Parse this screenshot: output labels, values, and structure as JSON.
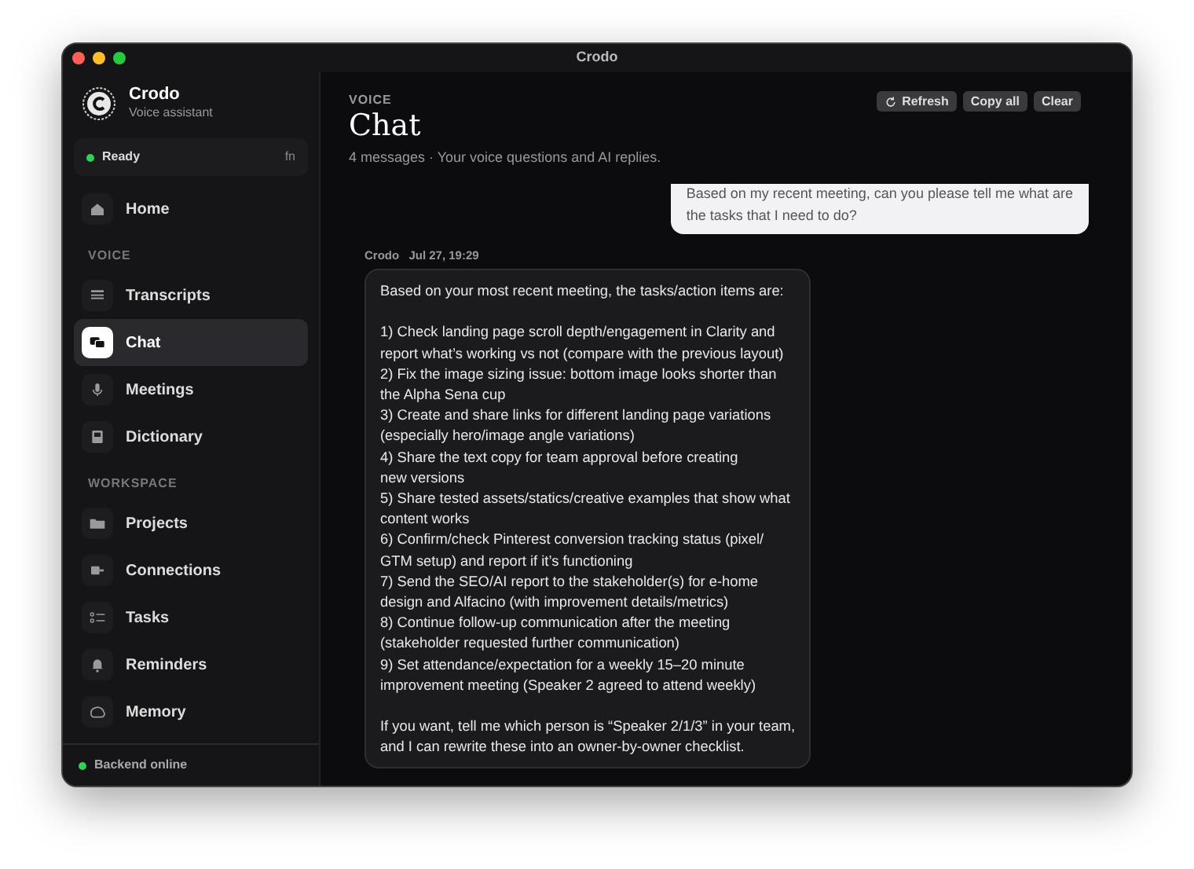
{
  "window": {
    "title": "Crodo"
  },
  "sidebar": {
    "app_name": "Crodo",
    "app_subtitle": "Voice assistant",
    "status": {
      "label": "Ready",
      "shortcut": "fn",
      "online": true
    },
    "sections": [
      {
        "items": [
          {
            "label": "Home",
            "selected": false
          }
        ]
      },
      {
        "heading": "VOICE",
        "items": [
          {
            "label": "Transcripts",
            "selected": false
          },
          {
            "label": "Chat",
            "selected": true
          },
          {
            "label": "Meetings",
            "selected": false
          },
          {
            "label": "Dictionary",
            "selected": false
          }
        ]
      },
      {
        "heading": "WORKSPACE",
        "items": [
          {
            "label": "Projects",
            "selected": false
          },
          {
            "label": "Connections",
            "selected": false
          },
          {
            "label": "Tasks",
            "selected": false
          },
          {
            "label": "Reminders",
            "selected": false
          },
          {
            "label": "Memory",
            "selected": false
          }
        ]
      }
    ],
    "footer": {
      "label": "Backend online",
      "online": true
    }
  },
  "header": {
    "eyebrow": "VOICE",
    "title": "Chat",
    "subtitle": "4 messages · Your voice questions and AI replies.",
    "buttons": [
      {
        "label": "Refresh",
        "kind": "refresh"
      },
      {
        "label": "Copy all",
        "kind": "plain"
      },
      {
        "label": "Clear",
        "kind": "plain"
      }
    ]
  },
  "messages": [
    {
      "kind": "user",
      "lines": [
        "Based on my recent meeting, can you please tell me what are",
        "the tasks that I need to do?"
      ]
    },
    {
      "kind": "assistant",
      "sender": "Crodo",
      "time": "Jul 27, 19:29",
      "paragraphs": [
        [
          "Based on your most recent meeting, the tasks/action items are:"
        ],
        [
          "1) Check landing page scroll depth/engagement in Clarity and",
          "report what’s working vs not (compare with the previous layout)",
          "2) Fix the image sizing issue: bottom image looks shorter than",
          "the Alpha Sena cup",
          "3) Create and share links for different landing page variations",
          "(especially hero/image angle variations)",
          "4) Share the text copy for team approval before creating",
          "new versions",
          "5) Share tested assets/statics/creative examples that show what",
          "content works",
          "6) Confirm/check Pinterest conversion tracking status (pixel/",
          "GTM setup) and report if it’s functioning",
          "7) Send the SEO/AI report to the stakeholder(s) for e-home",
          "design and Alfacino (with improvement details/metrics)",
          "8) Continue follow-up communication after the meeting",
          "(stakeholder requested further communication)",
          "9) Set attendance/expectation for a weekly 15–20 minute",
          "improvement meeting (Speaker 2 agreed to attend weekly)"
        ],
        [
          "If you want, tell me which person is “Speaker 2/1/3” in your team,",
          "and I can rewrite these into an owner-by-owner checklist."
        ]
      ]
    }
  ]
}
